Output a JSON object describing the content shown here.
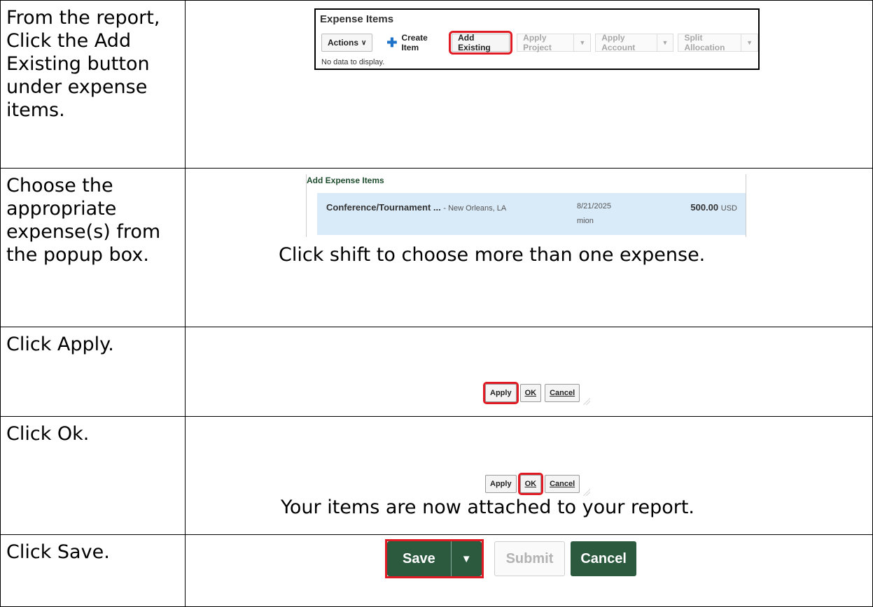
{
  "rows": [
    {
      "instruction": "From the report, Click the Add Existing button under expense items.",
      "panel": {
        "title": "Expense Items",
        "actions_label": "Actions",
        "create_label": "Create Item",
        "add_existing_label": "Add Existing",
        "apply_project_label": "Apply Project",
        "apply_account_label": "Apply Account",
        "split_allocation_label": "Split Allocation",
        "no_data": "No data to display."
      }
    },
    {
      "instruction": "Choose the appropriate expense(s) from the popup box.",
      "panel": {
        "title": "Add Expense Items",
        "item_name": "Conference/Tournament ...",
        "item_location": "- New Orleans, LA",
        "item_date": "8/21/2025",
        "item_sub": "mion",
        "item_amount": "500.00",
        "item_currency": "USD"
      },
      "caption": "Click shift to choose more than one expense."
    },
    {
      "instruction": "Click Apply.",
      "buttons": {
        "apply": "Apply",
        "ok": "OK",
        "cancel": "Cancel"
      }
    },
    {
      "instruction": "Click Ok.",
      "buttons": {
        "apply": "Apply",
        "ok": "OK",
        "cancel": "Cancel"
      },
      "caption": "Your items are now attached to your report."
    },
    {
      "instruction": "Click Save.",
      "buttons": {
        "save": "Save",
        "submit": "Submit",
        "cancel": "Cancel"
      }
    }
  ],
  "colors": {
    "highlight": "#e01b24",
    "primary_green": "#2b5a3f",
    "selected_row": "#d9eaf8",
    "plus_icon": "#1e73c8"
  },
  "icons": [
    "plus-icon",
    "chevron-down-icon",
    "dropdown-arrow-icon",
    "resize-grip-icon"
  ]
}
